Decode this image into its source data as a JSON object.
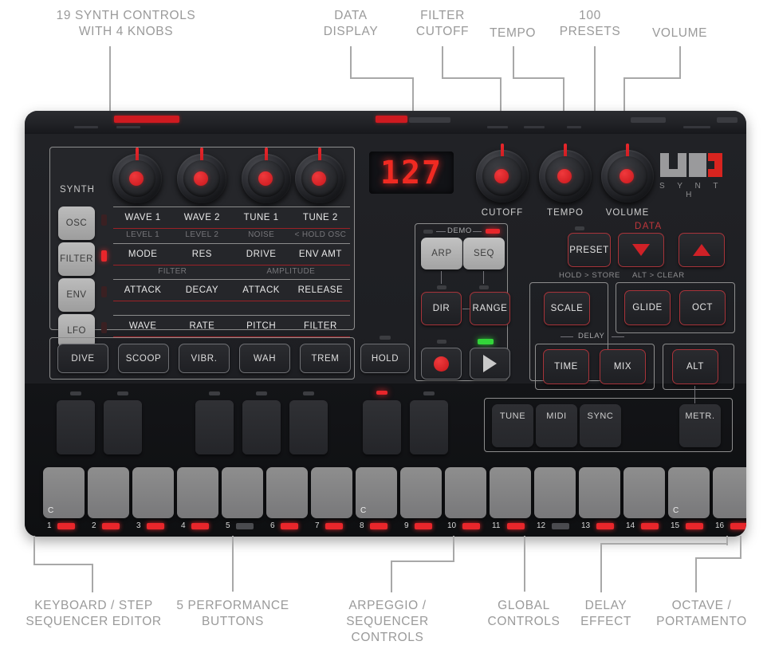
{
  "annotations": {
    "top": [
      {
        "text": "19 SYNTH CONTROLS\nWITH 4 KNOBS"
      },
      {
        "text": "DATA\nDISPLAY"
      },
      {
        "text": "FILTER\nCUTOFF"
      },
      {
        "text": "TEMPO"
      },
      {
        "text": "100\nPRESETS"
      },
      {
        "text": "VOLUME"
      }
    ],
    "bottom": [
      {
        "text": "KEYBOARD / STEP\nSEQUENCER EDITOR"
      },
      {
        "text": "5 PERFORMANCE\nBUTTONS"
      },
      {
        "text": "ARPEGGIO / SEQUENCER\nCONTROLS"
      },
      {
        "text": "GLOBAL\nCONTROLS"
      },
      {
        "text": "DELAY\nEFFECT"
      },
      {
        "text": "OCTAVE /\nPORTAMENTO"
      }
    ]
  },
  "device": {
    "logo": {
      "name": "UNO",
      "subtitle": "S Y N T H"
    },
    "display": {
      "value": "127"
    },
    "synth": {
      "section_label": "SYNTH",
      "mode_buttons": [
        {
          "label": "OSC",
          "led_on": false
        },
        {
          "label": "FILTER",
          "led_on": true
        },
        {
          "label": "ENV",
          "led_on": false
        },
        {
          "label": "LFO",
          "led_on": false
        }
      ],
      "rows": [
        {
          "primary": [
            "WAVE 1",
            "WAVE 2",
            "TUNE 1",
            "TUNE 2"
          ],
          "secondary": [
            "LEVEL 1",
            "LEVEL 2",
            "NOISE",
            "< HOLD OSC"
          ],
          "headers": []
        },
        {
          "primary": [
            "MODE",
            "RES",
            "DRIVE",
            "ENV AMT"
          ],
          "secondary": [],
          "headers": []
        },
        {
          "primary": [
            "ATTACK",
            "DECAY",
            "ATTACK",
            "RELEASE"
          ],
          "secondary": [],
          "headers": [
            "FILTER",
            "AMPLITUDE"
          ]
        },
        {
          "primary": [
            "WAVE",
            "RATE",
            "PITCH",
            "FILTER"
          ],
          "secondary": [],
          "headers": []
        }
      ]
    },
    "main_knobs": [
      {
        "label": "CUTOFF"
      },
      {
        "label": "TEMPO"
      },
      {
        "label": "VOLUME"
      }
    ],
    "performance_buttons": [
      {
        "label": "DIVE"
      },
      {
        "label": "SCOOP"
      },
      {
        "label": "VIBR."
      },
      {
        "label": "WAH"
      },
      {
        "label": "TREM"
      }
    ],
    "hold_button": {
      "label": "HOLD"
    },
    "arp_seq": {
      "demo_label": "DEMO",
      "buttons": [
        {
          "label": "ARP"
        },
        {
          "label": "SEQ"
        }
      ],
      "sub_buttons": [
        {
          "label": "DIR"
        },
        {
          "label": "RANGE"
        }
      ],
      "transport": [
        {
          "name": "record-button",
          "icon": "record-circle-icon"
        },
        {
          "name": "play-button",
          "icon": "play-triangle-icon"
        }
      ]
    },
    "global": {
      "preset_button": {
        "label": "PRESET",
        "caption": "HOLD > STORE"
      },
      "data_label": "DATA",
      "data_down": {
        "icon": "triangle-down-icon"
      },
      "data_up": {
        "icon": "triangle-up-icon"
      },
      "data_caption": "ALT > CLEAR",
      "scale_button": {
        "label": "SCALE"
      },
      "settings_pads": [
        {
          "label": "TUNE"
        },
        {
          "label": "MIDI"
        },
        {
          "label": "SYNC"
        }
      ],
      "metr_pad": {
        "label": "METR."
      }
    },
    "octave": {
      "glide_button": {
        "label": "GLIDE"
      },
      "oct_button": {
        "label": "OCT"
      }
    },
    "delay": {
      "label": "DELAY",
      "buttons": [
        {
          "label": "TIME"
        },
        {
          "label": "MIX"
        }
      ]
    },
    "alt_button": {
      "label": "ALT"
    },
    "keyboard": {
      "c_markers": [
        "C",
        "C",
        "C"
      ],
      "steps": [
        {
          "num": "1",
          "led": true
        },
        {
          "num": "2",
          "led": true
        },
        {
          "num": "3",
          "led": true
        },
        {
          "num": "4",
          "led": true
        },
        {
          "num": "5",
          "led": false
        },
        {
          "num": "6",
          "led": true
        },
        {
          "num": "7",
          "led": true
        },
        {
          "num": "8",
          "led": true
        },
        {
          "num": "9",
          "led": true
        },
        {
          "num": "10",
          "led": true
        },
        {
          "num": "11",
          "led": true
        },
        {
          "num": "12",
          "led": false
        },
        {
          "num": "13",
          "led": true
        },
        {
          "num": "14",
          "led": true
        },
        {
          "num": "15",
          "led": true
        },
        {
          "num": "16",
          "led": true
        }
      ]
    }
  },
  "colors": {
    "accent_red": "#e8262b",
    "panel_dark": "#1d1e22",
    "annotation_gray": "#9a9a9a",
    "led_green": "#33d43a"
  }
}
